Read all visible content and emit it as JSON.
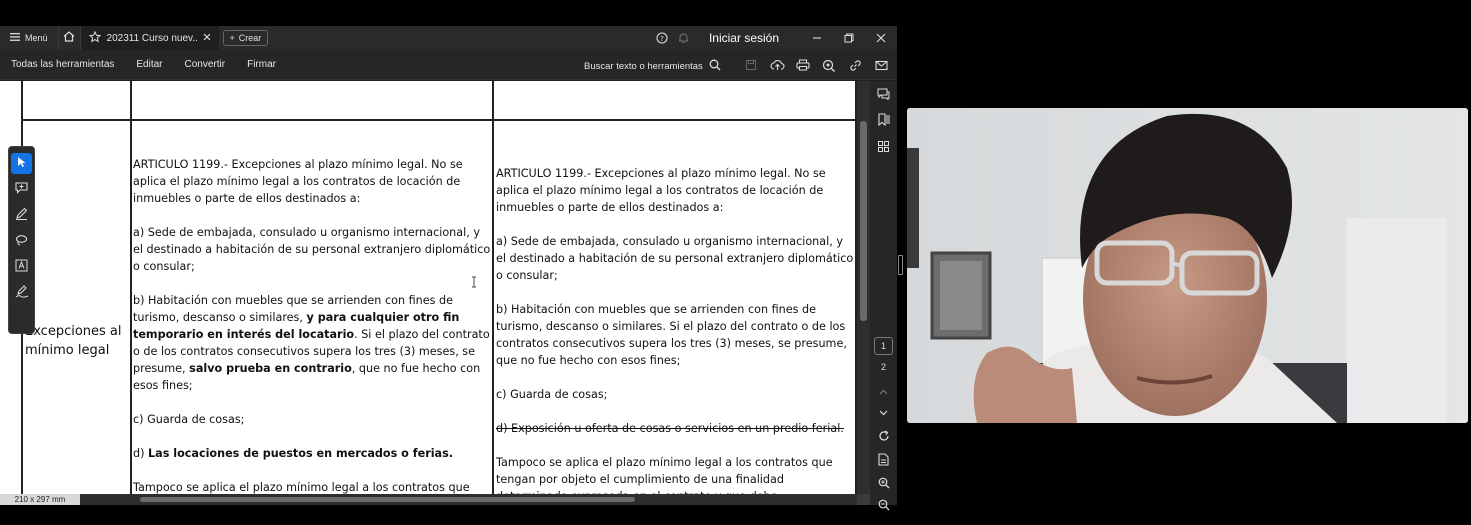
{
  "titlebar": {
    "menu_label": "Menú",
    "tab_title": "202311 Curso nuev...",
    "create_label": "Crear",
    "signin_label": "Iniciar sesión"
  },
  "toolbar": {
    "items": [
      "Todas las herramientas",
      "Editar",
      "Convertir",
      "Firmar"
    ],
    "search_label": "Buscar texto o herramientas"
  },
  "document": {
    "row_label": "Excepciones al mínimo legal",
    "left": {
      "p1": "ARTICULO 1199.- Excepciones al plazo mínimo legal. No se aplica el plazo mínimo legal a los contratos de locación de inmuebles o parte de ellos destinados a:",
      "p2": "a) Sede de embajada, consulado u organismo internacional, y el destinado a habitación de su personal extranjero diplomático o consular;",
      "p3_a": "b) Habitación con muebles que se arrienden con fines de turismo, descanso o similares, ",
      "p3_b": "y para cualquier otro fin temporario en interés del locatario",
      "p3_c": ". Si el plazo del contrato o de los contratos consecutivos supera los tres (3) meses, se presume, ",
      "p3_d": "salvo prueba en contrario",
      "p3_e": ", que no fue hecho con esos fines;",
      "p4": "c) Guarda de cosas;",
      "p5_a": "d) ",
      "p5_b": "Las locaciones de puestos en mercados o ferias.",
      "p6": "Tampoco se aplica el plazo mínimo legal a los contratos que tengan por objeto el cumplimiento de una finalidad determinada"
    },
    "right": {
      "p1": "ARTICULO 1199.- Excepciones al plazo mínimo legal. No se aplica el plazo mínimo legal a los contratos de locación de inmuebles o parte de ellos destinados a:",
      "p2": "a) Sede de embajada, consulado u organismo internacional, y el destinado a habitación de su personal extranjero diplomático o consular;",
      "p3": "b) Habitación con muebles que se arrienden con fines de turismo, descanso o similares. Si el plazo del contrato o de los contratos consecutivos supera los tres (3) meses, se presume, que no fue hecho con esos fines;",
      "p4": "c) Guarda de cosas;",
      "p5": "d) Exposición u oferta de cosas o servicios en un predio ferial.",
      "p6": "Tampoco se aplica el plazo mínimo legal a los contratos que tengan por objeto el cumplimiento de una finalidad determinada expresada en el contrato y que debe normalmente cumplirse en el"
    },
    "page_size": "210 x 297 mm"
  },
  "pages": {
    "items": [
      "1",
      "2"
    ],
    "current": "1"
  },
  "colors": {
    "accent": "#1473e6",
    "app_bg": "#1f1f1f",
    "toolbar_bg": "#262626"
  }
}
